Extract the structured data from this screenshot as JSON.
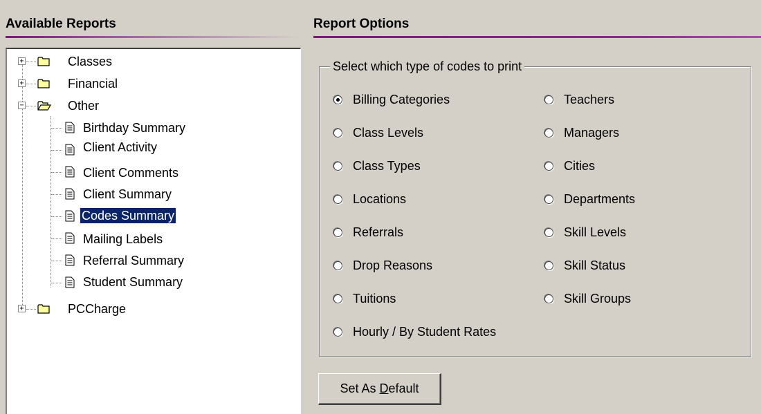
{
  "left_panel": {
    "header": "Available Reports",
    "tree": [
      {
        "label": "Classes",
        "type": "folder",
        "expanded": false
      },
      {
        "label": "Financial",
        "type": "folder",
        "expanded": false
      },
      {
        "label": "Other",
        "type": "folder",
        "expanded": true,
        "children": [
          {
            "label": "Birthday Summary"
          },
          {
            "label": "Client Activity"
          },
          {
            "label": "Client Comments"
          },
          {
            "label": "Client Summary"
          },
          {
            "label": "Codes Summary",
            "selected": true
          },
          {
            "label": "Mailing Labels"
          },
          {
            "label": "Referral Summary"
          },
          {
            "label": "Student Summary"
          }
        ]
      },
      {
        "label": "PCCharge",
        "type": "folder",
        "expanded": false
      }
    ]
  },
  "right_panel": {
    "header": "Report Options",
    "group_title": "Select which type of codes to print",
    "options_col1": [
      "Billing Categories",
      "Class Levels",
      "Class Types",
      "Locations",
      "Referrals",
      "Drop Reasons",
      "Tuitions",
      "Hourly / By Student Rates"
    ],
    "options_col2": [
      "Teachers",
      "Managers",
      "Cities",
      "Departments",
      "Skill Levels",
      "Skill Status",
      "Skill Groups"
    ],
    "selected_option": "Billing Categories",
    "default_button": {
      "before": "Set As ",
      "accel": "D",
      "after": "efault"
    }
  }
}
